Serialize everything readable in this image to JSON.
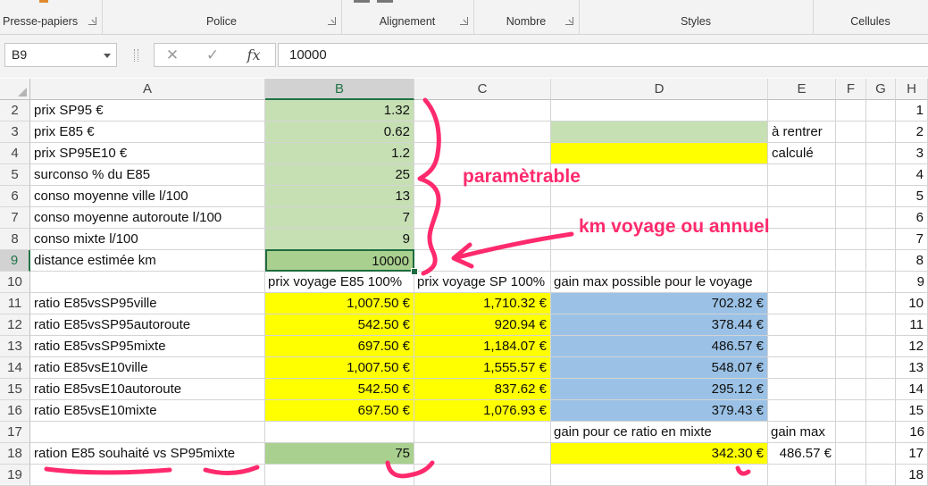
{
  "ribbon": {
    "groups": [
      "Presse-papiers",
      "Police",
      "Alignement",
      "Nombre",
      "Styles",
      "Cellules"
    ]
  },
  "formula_bar": {
    "name_box": "B9",
    "cancel_icon": "cross-icon",
    "enter_icon": "check-icon",
    "fx_label": "fx",
    "value": "10000"
  },
  "columns": [
    "A",
    "B",
    "C",
    "D",
    "E",
    "F",
    "G",
    "H"
  ],
  "selected_column": "B",
  "selected_row": "9",
  "rows": [
    {
      "n": "2",
      "A": "prix SP95 €",
      "B": "1.32",
      "H": "1"
    },
    {
      "n": "3",
      "A": "prix E85 €",
      "B": "0.62",
      "E": "à rentrer",
      "H": "2"
    },
    {
      "n": "4",
      "A": "prix SP95E10 €",
      "B": "1.2",
      "E": "calculé",
      "H": "3"
    },
    {
      "n": "5",
      "A": "surconso % du E85",
      "B": "25",
      "H": "4"
    },
    {
      "n": "6",
      "A": "conso moyenne ville l/100",
      "B": "13",
      "H": "5"
    },
    {
      "n": "7",
      "A": "conso moyenne autoroute l/100",
      "B": "7",
      "H": "6"
    },
    {
      "n": "8",
      "A": "conso mixte l/100",
      "B": "9",
      "H": "7"
    },
    {
      "n": "9",
      "A": "distance estimée km",
      "B": "10000",
      "H": "8"
    },
    {
      "n": "10",
      "B": "prix voyage E85 100%",
      "C": "prix voyage SP 100%",
      "D": "gain max possible pour le voyage",
      "H": "9"
    },
    {
      "n": "11",
      "A": "ratio E85vsSP95ville",
      "B": "1,007.50 €",
      "C": "1,710.32 €",
      "D": "702.82 €",
      "H": "10"
    },
    {
      "n": "12",
      "A": "ratio E85vsSP95autoroute",
      "B": "542.50 €",
      "C": "920.94 €",
      "D": "378.44 €",
      "H": "11"
    },
    {
      "n": "13",
      "A": "ratio E85vsSP95mixte",
      "B": "697.50 €",
      "C": "1,184.07 €",
      "D": "486.57 €",
      "H": "12"
    },
    {
      "n": "14",
      "A": "ratio E85vsE10ville",
      "B": "1,007.50 €",
      "C": "1,555.57 €",
      "D": "548.07 €",
      "H": "13"
    },
    {
      "n": "15",
      "A": "ratio E85vsE10autoroute",
      "B": "542.50 €",
      "C": "837.62 €",
      "D": "295.12 €",
      "H": "14"
    },
    {
      "n": "16",
      "A": "ratio E85vsE10mixte",
      "B": "697.50 €",
      "C": "1,076.93 €",
      "D": "379.43 €",
      "H": "15"
    },
    {
      "n": "17",
      "D": "gain pour ce ratio en mixte",
      "E": "gain max",
      "H": "16"
    },
    {
      "n": "18",
      "A": "ration E85 souhaité vs  SP95mixte",
      "B": "75",
      "D": "342.30 €",
      "E": "486.57 €",
      "H": "17"
    },
    {
      "n": "19",
      "H": "18"
    }
  ],
  "annotations": {
    "parametrable": "paramètrable",
    "km_voyage": "km voyage ou annuel",
    "color": "#ff2a6d"
  }
}
